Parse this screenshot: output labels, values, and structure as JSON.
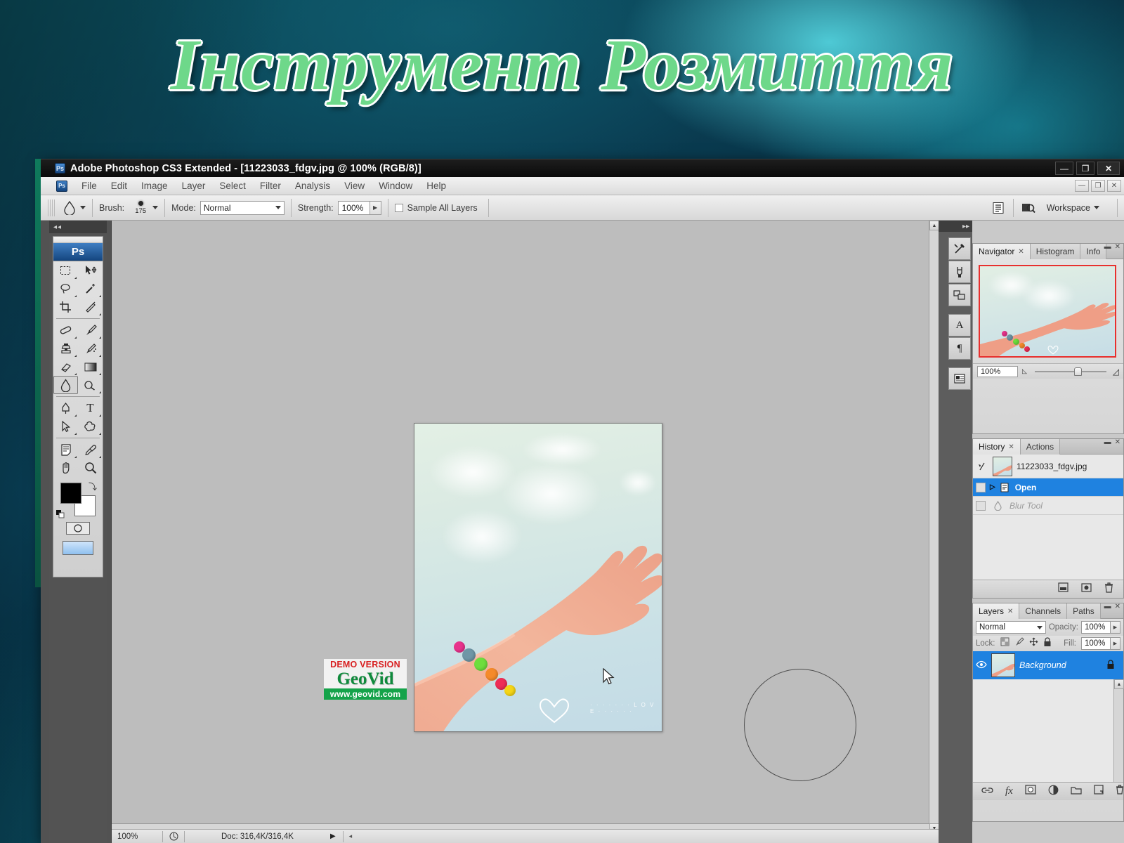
{
  "slide": {
    "title": "Інструмент Розмиття",
    "title_color": "#6ed88a",
    "background_color": "#0a3d52"
  },
  "window": {
    "title": "Adobe Photoshop CS3 Extended - [11223033_fdgv.jpg @ 100% (RGB/8)]",
    "app_badge": "Ps",
    "controls": {
      "minimize": "—",
      "restore": "❐",
      "close": "✕"
    },
    "doc_controls": {
      "minimize": "—",
      "restore": "❐",
      "close": "✕"
    }
  },
  "menubar": {
    "logo": "Ps",
    "items": [
      "File",
      "Edit",
      "Image",
      "Layer",
      "Select",
      "Filter",
      "Analysis",
      "View",
      "Window",
      "Help"
    ]
  },
  "options_bar": {
    "tool_icon": "blur-tool-icon",
    "brush_label": "Brush:",
    "brush_size": "175",
    "mode_label": "Mode:",
    "mode_value": "Normal",
    "strength_label": "Strength:",
    "strength_value": "100%",
    "sample_all_layers": "Sample All Layers",
    "workspace_label": "Workspace"
  },
  "toolbox": {
    "logo": "Ps",
    "tools": [
      {
        "name": "rectangular-marquee-tool",
        "glyph": "▭"
      },
      {
        "name": "move-tool",
        "glyph": "✥"
      },
      {
        "name": "lasso-tool",
        "glyph": "◯"
      },
      {
        "name": "magic-wand-tool",
        "glyph": "✳"
      },
      {
        "name": "crop-tool",
        "glyph": "⌗"
      },
      {
        "name": "slice-tool",
        "glyph": "✂"
      },
      {
        "name": "healing-brush-tool",
        "glyph": "⌇"
      },
      {
        "name": "brush-tool",
        "glyph": "🖌"
      },
      {
        "name": "clone-stamp-tool",
        "glyph": "⎈"
      },
      {
        "name": "history-brush-tool",
        "glyph": "↺"
      },
      {
        "name": "eraser-tool",
        "glyph": "▱"
      },
      {
        "name": "gradient-tool",
        "glyph": "▤"
      },
      {
        "name": "blur-tool",
        "glyph": "💧",
        "selected": true
      },
      {
        "name": "dodge-tool",
        "glyph": "◍"
      },
      {
        "name": "pen-tool",
        "glyph": "✒"
      },
      {
        "name": "type-tool",
        "glyph": "T"
      },
      {
        "name": "path-selection-tool",
        "glyph": "➤"
      },
      {
        "name": "custom-shape-tool",
        "glyph": "✿"
      },
      {
        "name": "notes-tool",
        "glyph": "🗒"
      },
      {
        "name": "eyedropper-tool",
        "glyph": "💉"
      },
      {
        "name": "hand-tool",
        "glyph": "✋"
      },
      {
        "name": "zoom-tool",
        "glyph": "🔍"
      }
    ],
    "foreground_color": "#000000",
    "background_color": "#ffffff"
  },
  "canvas": {
    "document_name": "11223033_fdgv.jpg",
    "brush_cursor_size": 160
  },
  "watermark": {
    "demo": "DEMO VERSION",
    "brand": "GeoVid",
    "url": "www.geovid.com",
    "demo_color": "#d81f20",
    "brand_color": "#0f8a3c",
    "url_bg": "#15a34a"
  },
  "statusbar": {
    "zoom": "100%",
    "doc_info": "Doc: 316,4K/316,4K"
  },
  "icon_dock": {
    "icons": [
      "tool-presets-icon",
      "brushes-icon",
      "clone-source-icon",
      "character-icon",
      "paragraph-icon",
      "layer-comps-icon"
    ]
  },
  "navigator_panel": {
    "tabs": [
      "Navigator",
      "Histogram",
      "Info"
    ],
    "active_tab": "Navigator",
    "zoom_value": "100%",
    "view_box_color": "#e8302e"
  },
  "history_panel": {
    "tabs": [
      "History",
      "Actions"
    ],
    "active_tab": "History",
    "snapshot": "11223033_fdgv.jpg",
    "states": [
      {
        "label": "Open",
        "selected": true
      },
      {
        "label": "Blur Tool",
        "selected": false,
        "disabled": true
      }
    ],
    "footer_icons": [
      "new-document-icon",
      "new-snapshot-icon",
      "delete-icon"
    ]
  },
  "layers_panel": {
    "tabs": [
      "Layers",
      "Channels",
      "Paths"
    ],
    "active_tab": "Layers",
    "blend_mode": "Normal",
    "opacity_label": "Opacity:",
    "opacity_value": "100%",
    "lock_label": "Lock:",
    "fill_label": "Fill:",
    "fill_value": "100%",
    "lock_icons": [
      "lock-transparent-icon",
      "lock-image-icon",
      "lock-position-icon",
      "lock-all-icon"
    ],
    "layers": [
      {
        "name": "Background",
        "locked": true,
        "selected": true
      }
    ],
    "footer_icons": [
      "link-layers-icon",
      "fx-icon",
      "add-mask-icon",
      "adjustment-layer-icon",
      "new-group-icon",
      "new-layer-icon",
      "delete-layer-icon"
    ]
  }
}
